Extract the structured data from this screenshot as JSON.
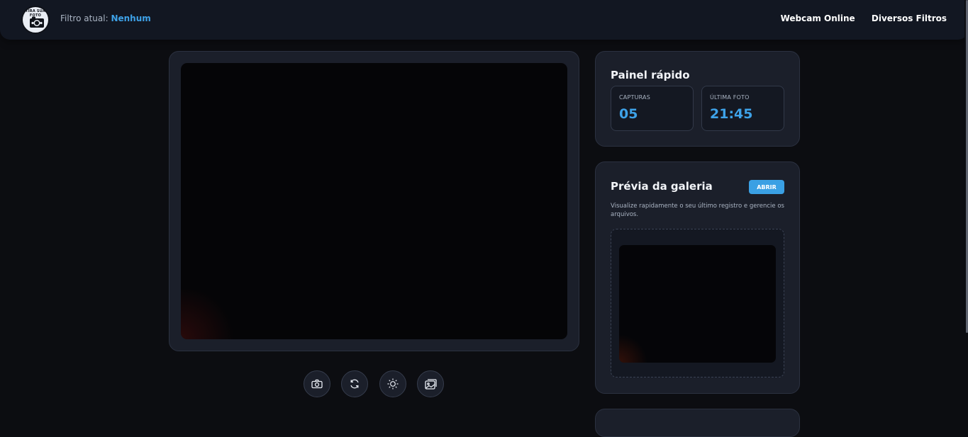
{
  "header": {
    "logo_text": "TIRA SUA FOTO",
    "filter_label": "Filtro atual:",
    "filter_value": "Nenhum",
    "nav": [
      "Webcam Online",
      "Diversos Filtros"
    ]
  },
  "controls": {
    "icons": [
      "camera-icon",
      "refresh-icon",
      "brightness-icon",
      "gallery-icon"
    ]
  },
  "quick_panel": {
    "title": "Painel rápido",
    "stats": [
      {
        "label": "CAPTURAS",
        "value": "05"
      },
      {
        "label": "ÚLTIMA FOTO",
        "value": "21:45"
      }
    ]
  },
  "gallery": {
    "title": "Prévia da galeria",
    "open_label": "ABRIR",
    "description": "Visualize rapidamente o seu último registro e gerencie os arquivos."
  },
  "colors": {
    "accent": "#3ea2e8",
    "card": "#1b1f2a",
    "background": "#0c0d11"
  }
}
